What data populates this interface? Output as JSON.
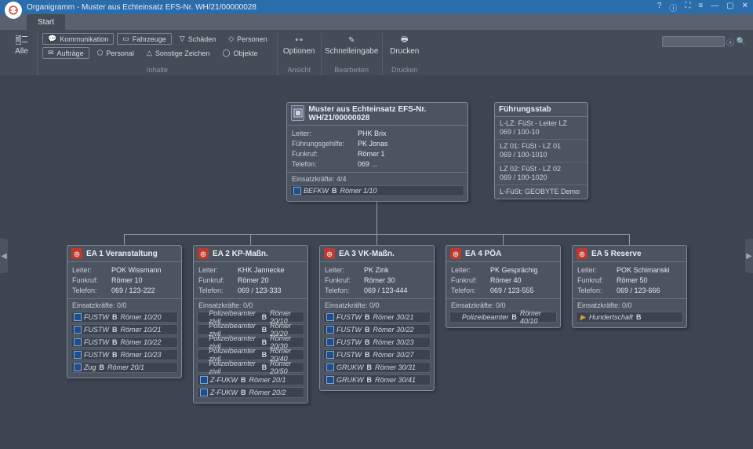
{
  "title": "Organigramm - Muster aus Echteinsatz EFS-Nr. WH/21/00000028",
  "tab": "Start",
  "ribbon": {
    "alle": "Alle",
    "kommunikation": "Kommunikation",
    "fahrzeuge": "Fahrzeuge",
    "schaden": "Schäden",
    "personen": "Personen",
    "auftrage": "Aufträge",
    "personal": "Personal",
    "sonstige": "Sonstige Zeichen",
    "objekte": "Objekte",
    "inhalte": "Inhalte",
    "ansicht": "Ansicht",
    "bearbeiten": "Bearbeiten",
    "drucken_sec": "Drucken",
    "optionen": "Optionen",
    "schnelleingabe": "Schnelleingabe",
    "drucken": "Drucken"
  },
  "root": {
    "title": "Muster aus Echteinsatz EFS-Nr. WH/21/00000028",
    "rows": [
      {
        "k": "Leiter:",
        "v": "PHK Brix"
      },
      {
        "k": "Führungsgehilfe:",
        "v": "PK Jonas"
      },
      {
        "k": "Funkruf:",
        "v": "Römer 1"
      },
      {
        "k": "Telefon:",
        "v": "069 ..."
      }
    ],
    "ek": "Einsatzkräfte:   4/4",
    "res": [
      {
        "t1": "BEFKW",
        "b": "B",
        "t2": "Römer 1/10",
        "cb": "blue"
      }
    ]
  },
  "fstab": {
    "title": "Führungsstab",
    "rows": [
      {
        "l1": "L-LZ: FüSt - Leiter LZ",
        "l2": "069 / 100-10"
      },
      {
        "l1": "LZ 01: FüSt - LZ 01",
        "l2": "069 / 100-1010"
      },
      {
        "l1": "LZ 02: FüSt - LZ 02",
        "l2": "069 / 100-1020"
      },
      {
        "l1": "L-FüSt: GEOBYTE Demo",
        "l2": ""
      }
    ]
  },
  "units": [
    {
      "title": "EA 1 Veranstaltung",
      "rows": [
        {
          "k": "Leiter:",
          "v": "POK Wissmann"
        },
        {
          "k": "Funkruf:",
          "v": "Römer 10"
        },
        {
          "k": "Telefon:",
          "v": "069 / 123-222"
        }
      ],
      "ek": "Einsatzkräfte: 0/0",
      "res": [
        {
          "t1": "FUSTW",
          "b": "B",
          "t2": "Römer 10/20",
          "cb": "blue"
        },
        {
          "t1": "FUSTW",
          "b": "B",
          "t2": "Römer 10/21",
          "cb": "blue"
        },
        {
          "t1": "FUSTW",
          "b": "B",
          "t2": "Römer 10/22",
          "cb": "blue"
        },
        {
          "t1": "FUSTW",
          "b": "B",
          "t2": "Römer 10/23",
          "cb": "blue"
        },
        {
          "t1": "Zug",
          "b": "B",
          "t2": "Römer 20/1",
          "cb": "blue"
        }
      ]
    },
    {
      "title": "EA 2 KP-Maßn.",
      "rows": [
        {
          "k": "Leiter:",
          "v": "KHK Jannecke"
        },
        {
          "k": "Funkruf:",
          "v": "Römer 20"
        },
        {
          "k": "Telefon:",
          "v": "069 / 123-333"
        }
      ],
      "ek": "Einsatzkräfte: 0/0",
      "res": [
        {
          "t1": "Polizeibeamter zivil",
          "b": "B",
          "t2": "Römer 20/10",
          "cb": ""
        },
        {
          "t1": "Polizeibeamter zivil",
          "b": "B",
          "t2": "Römer 20/20",
          "cb": ""
        },
        {
          "t1": "Polizeibeamter zivil",
          "b": "B",
          "t2": "Römer 20/30",
          "cb": ""
        },
        {
          "t1": "Polizeibeamter zivil",
          "b": "B",
          "t2": "Römer 20/40",
          "cb": ""
        },
        {
          "t1": "Polizeibeamter zivil",
          "b": "B",
          "t2": "Römer 20/50",
          "cb": ""
        },
        {
          "t1": "Z-FUKW",
          "b": "B",
          "t2": "Römer 20/1",
          "cb": "blue"
        },
        {
          "t1": "Z-FUKW",
          "b": "B",
          "t2": "Römer 20/2",
          "cb": "blue"
        }
      ]
    },
    {
      "title": "EA 3 VK-Maßn.",
      "rows": [
        {
          "k": "Leiter:",
          "v": "PK Zink"
        },
        {
          "k": "Funkruf:",
          "v": "Römer 30"
        },
        {
          "k": "Telefon:",
          "v": "069 / 123-444"
        }
      ],
      "ek": "Einsatzkräfte: 0/0",
      "res": [
        {
          "t1": "FUSTW",
          "b": "B",
          "t2": "Römer 30/21",
          "cb": "blue"
        },
        {
          "t1": "FUSTW",
          "b": "B",
          "t2": "Römer 30/22",
          "cb": "blue"
        },
        {
          "t1": "FUSTW",
          "b": "B",
          "t2": "Römer 30/23",
          "cb": "blue"
        },
        {
          "t1": "FUSTW",
          "b": "B",
          "t2": "Römer 30/27",
          "cb": "blue"
        },
        {
          "t1": "GRUKW",
          "b": "B",
          "t2": "Römer 30/31",
          "cb": "blue"
        },
        {
          "t1": "GRUKW",
          "b": "B",
          "t2": "Römer 30/41",
          "cb": "blue"
        }
      ]
    },
    {
      "title": "EA 4 PÖA",
      "rows": [
        {
          "k": "Leiter:",
          "v": "PK Gesprächig"
        },
        {
          "k": "Funkruf:",
          "v": "Römer 40"
        },
        {
          "k": "Telefon:",
          "v": "069 / 123-555"
        }
      ],
      "ek": "Einsatzkräfte: 0/0",
      "res": [
        {
          "t1": "Polizeibeamter",
          "b": "B",
          "t2": "Römer 40/10",
          "cb": ""
        }
      ]
    },
    {
      "title": "EA 5 Reserve",
      "rows": [
        {
          "k": "Leiter:",
          "v": "POK Schimanski"
        },
        {
          "k": "Funkruf:",
          "v": "Römer 50"
        },
        {
          "k": "Telefon:",
          "v": "069 / 123-666"
        }
      ],
      "ek": "Einsatzkräfte: 0/0",
      "res": [
        {
          "t1": "Hundertschaft",
          "b": "B",
          "t2": "",
          "cb": "play"
        }
      ]
    }
  ]
}
